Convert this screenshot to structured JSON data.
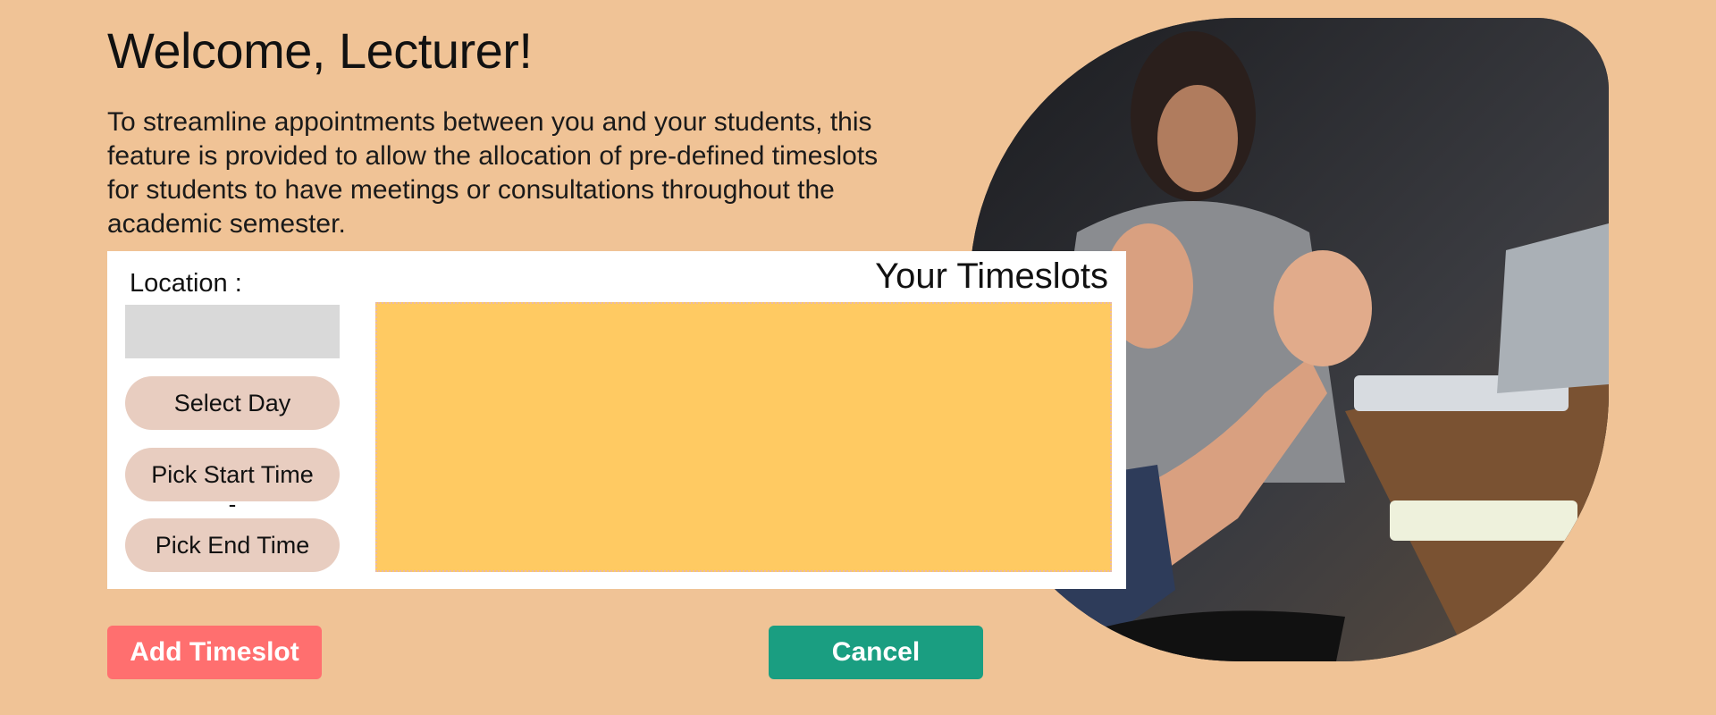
{
  "header": {
    "title": "Welcome, Lecturer!",
    "intro": "To streamline appointments between you and your students, this feature is provided to allow the allocation of pre-defined timeslots for students to have meetings or consultations throughout the academic semester."
  },
  "form": {
    "location_label": "Location :",
    "location_value": "",
    "select_day_label": "Select Day",
    "start_time_label": "Pick Start Time",
    "separator": "-",
    "end_time_label": "Pick End Time"
  },
  "timeslots": {
    "title": "Your Timeslots",
    "items": []
  },
  "actions": {
    "add_label": "Add Timeslot",
    "cancel_label": "Cancel"
  },
  "colors": {
    "background": "#f0c396",
    "timeslot_area": "#ffca62",
    "add_button": "#ff6f6f",
    "cancel_button": "#1a9e81",
    "pill_button": "#e8cdc0",
    "input": "#d9d9d9"
  },
  "image": {
    "icon": "classroom-photo"
  }
}
